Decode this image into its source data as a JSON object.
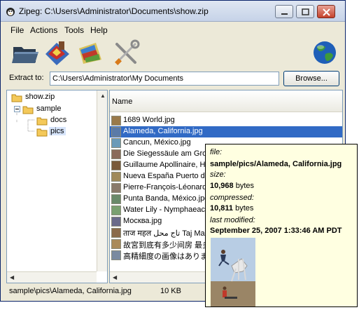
{
  "window": {
    "title": "Zipeg: C:\\Users\\Administrator\\Documents\\show.zip"
  },
  "menu": [
    "File",
    "Actions",
    "Tools",
    "Help"
  ],
  "toolbar": {
    "icons": [
      "open-folder-icon",
      "extract-icon",
      "extract-selected-icon",
      "options-tools-icon",
      "globe-icon"
    ]
  },
  "extract": {
    "label": "Extract to:",
    "value": "C:\\Users\\Administrator\\My Documents",
    "browse_label": "Browse..."
  },
  "tree": {
    "items": [
      {
        "label": "show.zip",
        "level": 0
      },
      {
        "label": "sample",
        "level": 1
      },
      {
        "label": "docs",
        "level": 2
      },
      {
        "label": "pics",
        "level": 2,
        "selected": true
      }
    ]
  },
  "list": {
    "column_header": "Name",
    "rows": [
      {
        "name": "1689 World.jpg"
      },
      {
        "name": "Alameda, California.jpg",
        "selected": true
      },
      {
        "name": "Cancun, México.jpg"
      },
      {
        "name": "Die Siegessäule am Groß"
      },
      {
        "name": "Guillaume Apollinaire, Ho"
      },
      {
        "name": "Nueva España Puerto de"
      },
      {
        "name": "Pierre-François-Léonard"
      },
      {
        "name": "Punta Banda, México.jpg"
      },
      {
        "name": "Water Lily - Nymphaeac"
      },
      {
        "name": "Москва.jpg"
      },
      {
        "name": "ताज महल تاج محل Taj Mah"
      },
      {
        "name": "故宮到底有多少间房 最多"
      },
      {
        "name": "高精細度の画像はありま"
      }
    ]
  },
  "status": {
    "path": "sample\\pics\\Alameda, California.jpg",
    "size": "10 KB"
  },
  "tooltip": {
    "file_label": "file:",
    "file_value": "sample/pics/Alameda, California.jpg",
    "size_label": "size:",
    "size_value": "10,968",
    "size_unit": " bytes",
    "compressed_label": "compressed:",
    "compressed_value": "10,811",
    "compressed_unit": " bytes",
    "modified_label": "last modified:",
    "modified_value": "September 25, 2007 1:33:46 AM PDT"
  },
  "colors": {
    "selection": "#316ac5",
    "tooltip_bg": "#ffffe1",
    "window_bg": "#ece9d8"
  }
}
